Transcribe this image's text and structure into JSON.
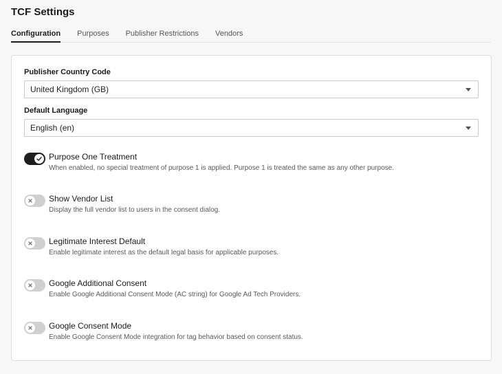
{
  "page": {
    "title": "TCF Settings"
  },
  "tabs": [
    {
      "label": "Configuration",
      "active": true
    },
    {
      "label": "Purposes",
      "active": false
    },
    {
      "label": "Publisher Restrictions",
      "active": false
    },
    {
      "label": "Vendors",
      "active": false
    }
  ],
  "form": {
    "country": {
      "label": "Publisher Country Code",
      "value": "United Kingdom (GB)"
    },
    "language": {
      "label": "Default Language",
      "value": "English (en)"
    }
  },
  "options": [
    {
      "title": "Purpose One Treatment",
      "description": "When enabled, no special treatment of purpose 1 is applied. Purpose 1 is treated the same as any other purpose.",
      "enabled": true
    },
    {
      "title": "Show Vendor List",
      "description": "Display the full vendor list to users in the consent dialog.",
      "enabled": false
    },
    {
      "title": "Legitimate Interest Default",
      "description": "Enable legitimate interest as the default legal basis for applicable purposes.",
      "enabled": false
    },
    {
      "title": "Google Additional Consent",
      "description": "Enable Google Additional Consent Mode (AC string) for Google Ad Tech Providers.",
      "enabled": false
    },
    {
      "title": "Google Consent Mode",
      "description": "Enable Google Consent Mode integration for tag behavior based on consent status.",
      "enabled": false
    }
  ],
  "colors": {
    "toggle_on": "#1f1f1f",
    "toggle_off": "#d0d0d0",
    "accent": "#1b1b1b"
  }
}
